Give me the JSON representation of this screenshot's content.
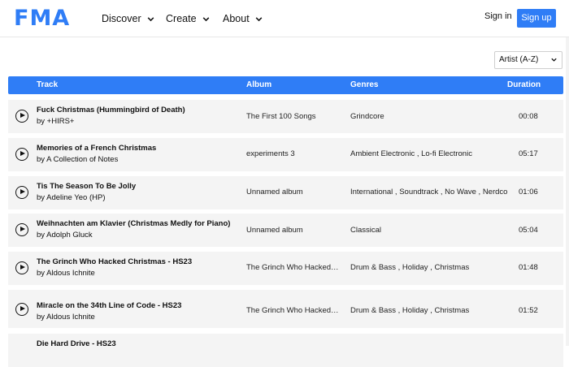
{
  "header": {
    "logo": "FMA",
    "nav": [
      "Discover",
      "Create",
      "About"
    ],
    "sign_in": "Sign in",
    "sign_up": "Sign up"
  },
  "sort": {
    "selected": "Artist (A-Z)"
  },
  "table": {
    "columns": [
      "Track",
      "Album",
      "Genres",
      "Duration"
    ],
    "rows": [
      {
        "title": "Fuck Christmas (Hummingbird of Death)",
        "artist": "by +HIRS+",
        "album": "The First 100 Songs",
        "genres": "Grindcore",
        "duration": "00:08"
      },
      {
        "title": "Memories of a French Christmas",
        "artist": "by A Collection of Notes",
        "album": "experiments 3",
        "genres": "Ambient Electronic , Lo-fi Electronic",
        "duration": "05:17"
      },
      {
        "title": "Tis The Season To Be Jolly",
        "artist": "by Adeline Yeo (HP)",
        "album": "Unnamed album",
        "genres": "International , Soundtrack , No Wave , Nerdcore , I",
        "duration": "01:06"
      },
      {
        "title": "Weihnachten am Klavier (Christmas Medly for Piano)",
        "artist": "by Adolph Gluck",
        "album": "Unnamed album",
        "genres": "Classical",
        "duration": "05:04"
      },
      {
        "title": "The Grinch Who Hacked Christmas - HS23",
        "artist": "by Aldous Ichnite",
        "album": "The Grinch Who Hacked C...",
        "genres": "Drum & Bass , Holiday , Christmas",
        "duration": "01:48"
      },
      {
        "title": "Miracle on the 34th Line of Code - HS23",
        "artist": "by Aldous Ichnite",
        "album": "The Grinch Who Hacked C...",
        "genres": "Drum & Bass , Holiday , Christmas",
        "duration": "01:52"
      },
      {
        "title": "Die Hard Drive - HS23",
        "artist": "",
        "album": "",
        "genres": "",
        "duration": ""
      }
    ]
  }
}
